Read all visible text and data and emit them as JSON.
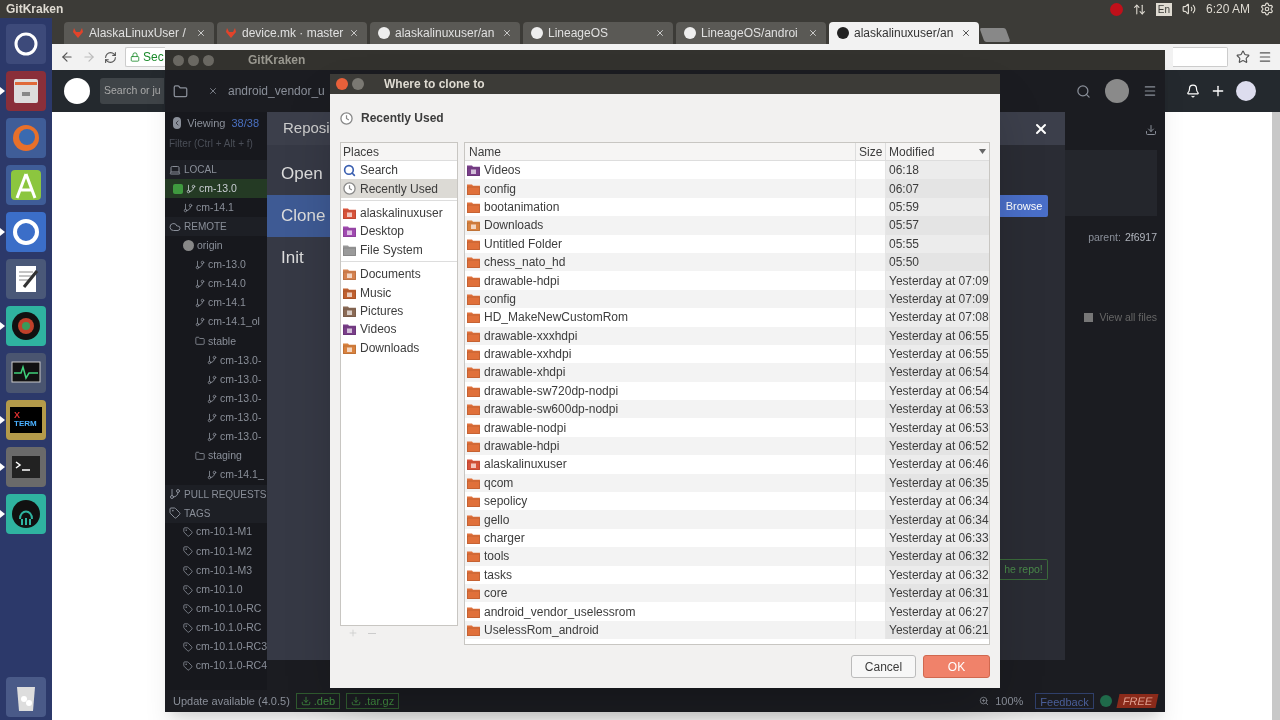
{
  "top_panel": {
    "app_title": "GitKraken",
    "keyboard": "En",
    "clock": "6:20 AM"
  },
  "launcher": [
    {
      "kind": "ubuntu",
      "running": false
    },
    {
      "kind": "files",
      "running": true
    },
    {
      "kind": "firefox",
      "running": false
    },
    {
      "kind": "android",
      "running": false
    },
    {
      "kind": "chromium",
      "running": true
    },
    {
      "kind": "editor",
      "running": false
    },
    {
      "kind": "lens",
      "running": true
    },
    {
      "kind": "monitor",
      "running": false
    },
    {
      "kind": "xterm",
      "running": true,
      "label_top": "X",
      "label": "TERM"
    },
    {
      "kind": "terminal",
      "running": true
    },
    {
      "kind": "gitkraken",
      "running": true
    },
    {
      "kind": "trash",
      "running": false
    }
  ],
  "browser": {
    "tabs": [
      {
        "label": "AlaskaLinuxUser / ",
        "kind": "gitlab",
        "selected": false
      },
      {
        "label": "device.mk · master",
        "kind": "gitlab",
        "selected": false
      },
      {
        "label": "alaskalinuxuser/an",
        "kind": "github",
        "selected": false
      },
      {
        "label": "LineageOS",
        "kind": "github",
        "selected": false
      },
      {
        "label": "LineageOS/androi",
        "kind": "github",
        "selected": false
      },
      {
        "label": "alaskalinuxuser/an",
        "kind": "github",
        "selected": true
      }
    ],
    "address": "Sec",
    "search_placeholder": "Search or ju"
  },
  "gitkraken": {
    "title": "GitKraken",
    "repo_tab": "android_vendor_u",
    "viewing": {
      "label": "Viewing",
      "count": "38/38"
    },
    "filter_placeholder": "Filter (Ctrl + Alt + f)",
    "sidebar": [
      {
        "kind": "section",
        "label": "LOCAL",
        "children": [
          {
            "kind": "branch",
            "label": "cm-13.0",
            "selected": true
          },
          {
            "kind": "branch",
            "label": "cm-14.1",
            "selected": false
          }
        ]
      },
      {
        "kind": "section",
        "label": "REMOTE",
        "children": [
          {
            "kind": "remote",
            "label": "origin",
            "children": [
              {
                "kind": "branch",
                "label": "cm-13.0",
                "selected": false
              },
              {
                "kind": "branch",
                "label": "cm-14.0",
                "selected": false
              },
              {
                "kind": "branch",
                "label": "cm-14.1",
                "selected": false
              },
              {
                "kind": "branch",
                "label": "cm-14.1_ol",
                "selected": false
              },
              {
                "kind": "folder",
                "label": "stable",
                "children": [
                  {
                    "kind": "branch",
                    "label": "cm-13.0-",
                    "selected": false
                  },
                  {
                    "kind": "branch",
                    "label": "cm-13.0-",
                    "selected": false
                  },
                  {
                    "kind": "branch",
                    "label": "cm-13.0-",
                    "selected": false
                  },
                  {
                    "kind": "branch",
                    "label": "cm-13.0-",
                    "selected": false
                  },
                  {
                    "kind": "branch",
                    "label": "cm-13.0-",
                    "selected": false
                  }
                ]
              },
              {
                "kind": "folder",
                "label": "staging",
                "children": [
                  {
                    "kind": "branch",
                    "label": "cm-14.1_",
                    "selected": false
                  }
                ]
              }
            ]
          }
        ]
      },
      {
        "kind": "pr",
        "label": "PULL REQUESTS"
      },
      {
        "kind": "tags",
        "label": "TAGS",
        "children": [
          {
            "kind": "tag",
            "label": "cm-10.1-M1"
          },
          {
            "kind": "tag",
            "label": "cm-10.1-M2"
          },
          {
            "kind": "tag",
            "label": "cm-10.1-M3"
          },
          {
            "kind": "tag",
            "label": "cm-10.1.0"
          },
          {
            "kind": "tag",
            "label": "cm-10.1.0-RC"
          },
          {
            "kind": "tag",
            "label": "cm-10.1.0-RC"
          },
          {
            "kind": "tag",
            "label": "cm-10.1.0-RC3"
          },
          {
            "kind": "tag",
            "label": "cm-10.1.0-RC4"
          }
        ]
      }
    ],
    "parent": {
      "label": "parent:",
      "value": "2f6917"
    },
    "view_all_files": {
      "label": "View all files",
      "checked": false
    },
    "modal": {
      "header": "Reposi",
      "menu": [
        {
          "label": "Open",
          "selected": false
        },
        {
          "label": "Clone",
          "selected": true
        },
        {
          "label": "Init",
          "selected": false
        }
      ],
      "browse": "Browse",
      "submit": "he repo!"
    },
    "status_bar": {
      "update": "Update available (4.0.5)",
      "downloads": [
        ".deb",
        ".tar.gz"
      ],
      "zoom": "100%",
      "feedback": "Feedback",
      "plan": "FREE"
    }
  },
  "dialog": {
    "title": "Where to clone to",
    "location": "Recently Used",
    "places_header": "Places",
    "places": [
      [
        {
          "label": "Search",
          "kind": "search",
          "selected": false
        },
        {
          "label": "Recently Used",
          "kind": "recent",
          "selected": true
        }
      ],
      [
        {
          "label": "alaskalinuxuser",
          "kind": "home",
          "selected": false
        },
        {
          "label": "Desktop",
          "kind": "desktop",
          "selected": false
        },
        {
          "label": "File System",
          "kind": "drive",
          "selected": false
        }
      ],
      [
        {
          "label": "Documents",
          "kind": "documents",
          "selected": false
        },
        {
          "label": "Music",
          "kind": "music",
          "selected": false
        },
        {
          "label": "Pictures",
          "kind": "pictures",
          "selected": false
        },
        {
          "label": "Videos",
          "kind": "videos",
          "selected": false
        },
        {
          "label": "Downloads",
          "kind": "downloads",
          "selected": false
        }
      ]
    ],
    "columns": [
      "Name",
      "Size",
      "Modified"
    ],
    "rows": [
      {
        "name": "Videos",
        "kind": "videos",
        "modified": "06:18"
      },
      {
        "name": "config",
        "kind": "folder",
        "modified": "06:07"
      },
      {
        "name": "bootanimation",
        "kind": "folder",
        "modified": "05:59"
      },
      {
        "name": "Downloads",
        "kind": "downloads",
        "modified": "05:57"
      },
      {
        "name": "Untitled Folder",
        "kind": "folder",
        "modified": "05:55"
      },
      {
        "name": "chess_nato_hd",
        "kind": "folder",
        "modified": "05:50"
      },
      {
        "name": "drawable-hdpi",
        "kind": "folder",
        "modified": "Yesterday at 07:09"
      },
      {
        "name": "config",
        "kind": "folder",
        "modified": "Yesterday at 07:09"
      },
      {
        "name": "HD_MakeNewCustomRom",
        "kind": "folder",
        "modified": "Yesterday at 07:08"
      },
      {
        "name": "drawable-xxxhdpi",
        "kind": "folder",
        "modified": "Yesterday at 06:55"
      },
      {
        "name": "drawable-xxhdpi",
        "kind": "folder",
        "modified": "Yesterday at 06:55"
      },
      {
        "name": "drawable-xhdpi",
        "kind": "folder",
        "modified": "Yesterday at 06:54"
      },
      {
        "name": "drawable-sw720dp-nodpi",
        "kind": "folder",
        "modified": "Yesterday at 06:54"
      },
      {
        "name": "drawable-sw600dp-nodpi",
        "kind": "folder",
        "modified": "Yesterday at 06:53"
      },
      {
        "name": "drawable-nodpi",
        "kind": "folder",
        "modified": "Yesterday at 06:53"
      },
      {
        "name": "drawable-hdpi",
        "kind": "folder",
        "modified": "Yesterday at 06:52"
      },
      {
        "name": "alaskalinuxuser",
        "kind": "home",
        "modified": "Yesterday at 06:46"
      },
      {
        "name": "qcom",
        "kind": "folder",
        "modified": "Yesterday at 06:35"
      },
      {
        "name": "sepolicy",
        "kind": "folder",
        "modified": "Yesterday at 06:34"
      },
      {
        "name": "gello",
        "kind": "folder",
        "modified": "Yesterday at 06:34"
      },
      {
        "name": "charger",
        "kind": "folder",
        "modified": "Yesterday at 06:33"
      },
      {
        "name": "tools",
        "kind": "folder",
        "modified": "Yesterday at 06:32"
      },
      {
        "name": "tasks",
        "kind": "folder",
        "modified": "Yesterday at 06:32"
      },
      {
        "name": "core",
        "kind": "folder",
        "modified": "Yesterday at 06:31"
      },
      {
        "name": "android_vendor_uselessrom",
        "kind": "folder",
        "modified": "Yesterday at 06:27"
      },
      {
        "name": "UselessRom_android",
        "kind": "folder",
        "modified": "Yesterday at 06:21"
      }
    ],
    "buttons": [
      {
        "label": "Cancel",
        "kind": "secondary"
      },
      {
        "label": "OK",
        "kind": "primary"
      }
    ]
  }
}
